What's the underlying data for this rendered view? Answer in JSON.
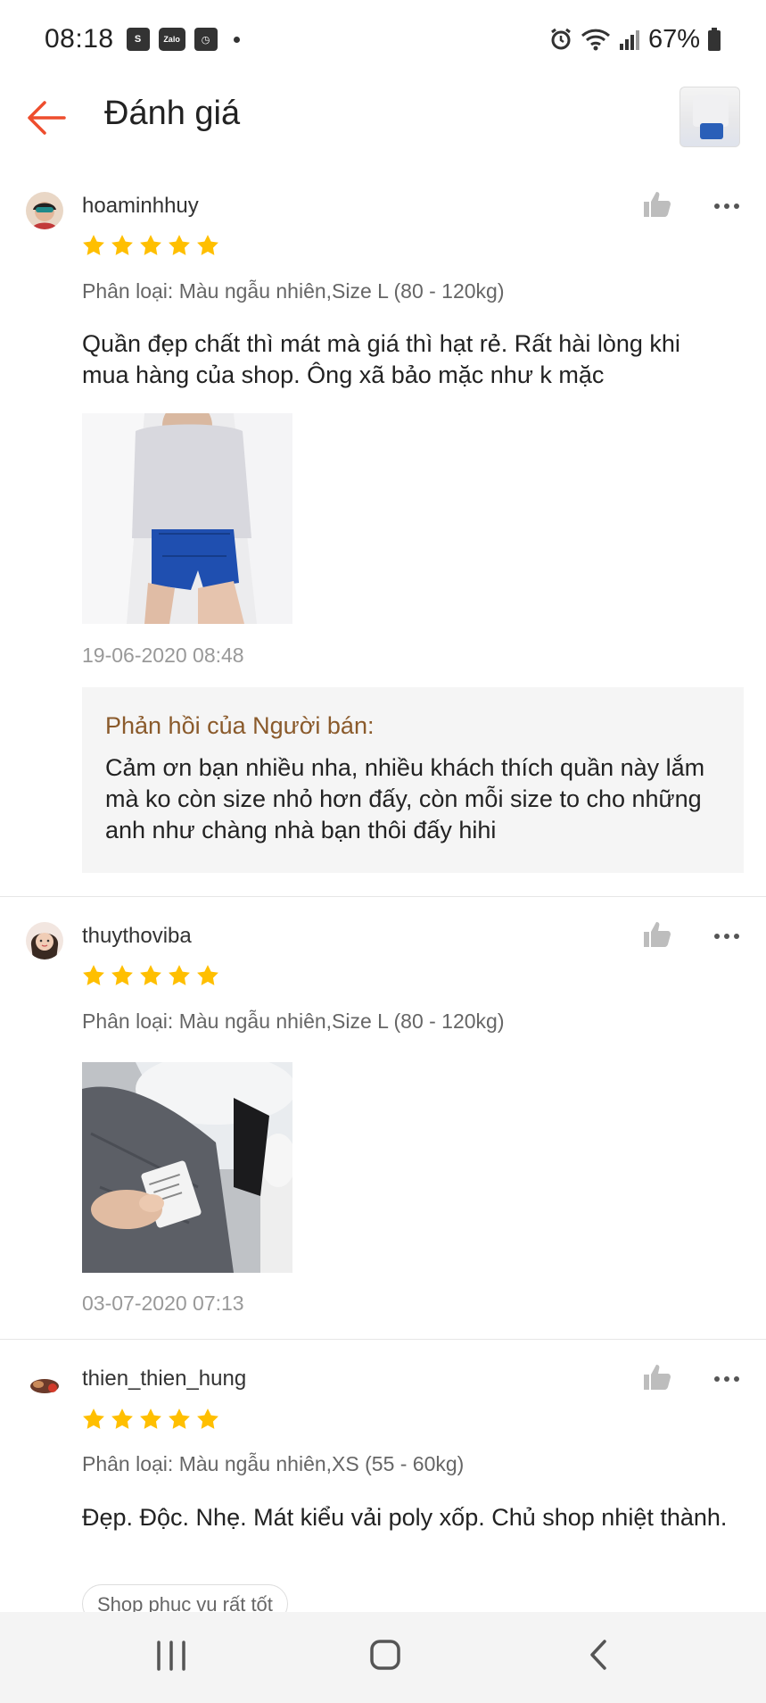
{
  "status": {
    "time": "08:18",
    "icons": [
      "shopee-icon",
      "zalo-icon",
      "clock-app-icon",
      "notification-dot"
    ],
    "zalo_label": "Zalo",
    "battery": "67%"
  },
  "header": {
    "title": "Đánh giá"
  },
  "reviews": [
    {
      "username": "hoaminhhuy",
      "rating": 5,
      "variant": "Phân loại: Màu ngẫu nhiên,Size L (80 - 120kg)",
      "comment": "Quần đẹp chất thì mát mà giá thì hạt rẻ. Rất hài lòng khi mua hàng của shop. Ông xã bảo mặc như k mặc",
      "date": "19-06-2020 08:48",
      "seller_reply": {
        "title": "Phản hồi của Người bán:",
        "text": "Cảm ơn bạn nhiều nha, nhiều khách thích quần này lắm mà ko còn size nhỏ hơn đấy, còn mỗi size to cho những anh như chàng nhà bạn thôi đấy hihi"
      }
    },
    {
      "username": "thuythoviba",
      "rating": 5,
      "variant": "Phân loại: Màu ngẫu nhiên,Size L (80 - 120kg)",
      "date": "03-07-2020 07:13"
    },
    {
      "username": "thien_thien_hung",
      "rating": 5,
      "variant": "Phân loại: Màu ngẫu nhiên,XS (55 - 60kg)",
      "comment": "Đẹp. Độc. Nhẹ. Mát kiểu vải poly xốp. Chủ shop nhiệt thành.",
      "tag": "Shop phục vụ rất tốt"
    }
  ],
  "colors": {
    "accent": "#ee4d2d",
    "star": "#ffbf00",
    "seller_reply_title": "#8a5a2b"
  }
}
